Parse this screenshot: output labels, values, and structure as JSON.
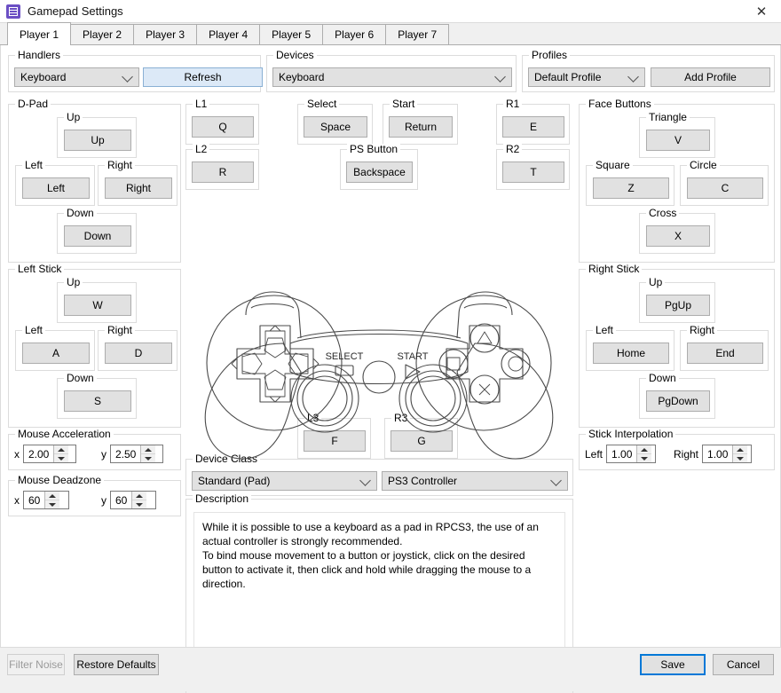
{
  "window": {
    "title": "Gamepad Settings",
    "icon": "rpcs3-icon",
    "close_label": "✕"
  },
  "tabs": [
    {
      "label": "Player 1",
      "active": true
    },
    {
      "label": "Player 2",
      "active": false
    },
    {
      "label": "Player 3",
      "active": false
    },
    {
      "label": "Player 4",
      "active": false
    },
    {
      "label": "Player 5",
      "active": false
    },
    {
      "label": "Player 6",
      "active": false
    },
    {
      "label": "Player 7",
      "active": false
    }
  ],
  "handlers": {
    "title": "Handlers",
    "value": "Keyboard",
    "refresh_label": "Refresh"
  },
  "devices": {
    "title": "Devices",
    "value": "Keyboard"
  },
  "profiles": {
    "title": "Profiles",
    "value": "Default Profile",
    "add_label": "Add Profile"
  },
  "dpad": {
    "title": "D-Pad",
    "up_label": "Up",
    "up_value": "Up",
    "left_label": "Left",
    "left_value": "Left",
    "right_label": "Right",
    "right_value": "Right",
    "down_label": "Down",
    "down_value": "Down"
  },
  "left_stick": {
    "title": "Left Stick",
    "up_label": "Up",
    "up_value": "W",
    "left_label": "Left",
    "left_value": "A",
    "right_label": "Right",
    "right_value": "D",
    "down_label": "Down",
    "down_value": "S"
  },
  "right_stick": {
    "title": "Right Stick",
    "up_label": "Up",
    "up_value": "PgUp",
    "left_label": "Left",
    "left_value": "Home",
    "right_label": "Right",
    "right_value": "End",
    "down_label": "Down",
    "down_value": "PgDown"
  },
  "face_buttons": {
    "title": "Face Buttons",
    "triangle_label": "Triangle",
    "triangle_value": "V",
    "square_label": "Square",
    "square_value": "Z",
    "circle_label": "Circle",
    "circle_value": "C",
    "cross_label": "Cross",
    "cross_value": "X"
  },
  "shoulders": {
    "l1_label": "L1",
    "l1_value": "Q",
    "l2_label": "L2",
    "l2_value": "R",
    "r1_label": "R1",
    "r1_value": "E",
    "r2_label": "R2",
    "r2_value": "T",
    "l3_label": "L3",
    "l3_value": "F",
    "r3_label": "R3",
    "r3_value": "G"
  },
  "center": {
    "select_label": "Select",
    "select_value": "Space",
    "start_label": "Start",
    "start_value": "Return",
    "ps_label": "PS Button",
    "ps_value": "Backspace"
  },
  "mouse_acceleration": {
    "title": "Mouse Acceleration",
    "x_label": "x",
    "x_value": "2.00",
    "y_label": "y",
    "y_value": "2.50"
  },
  "mouse_deadzone": {
    "title": "Mouse Deadzone",
    "x_label": "x",
    "x_value": "60",
    "y_label": "y",
    "y_value": "60"
  },
  "stick_interpolation": {
    "title": "Stick Interpolation",
    "left_label": "Left",
    "left_value": "1.00",
    "right_label": "Right",
    "right_value": "1.00"
  },
  "device_class": {
    "title": "Device Class",
    "class_value": "Standard (Pad)",
    "controller_value": "PS3 Controller"
  },
  "description": {
    "title": "Description",
    "text": "While it is possible to use a keyboard as a pad in RPCS3, the use of an actual controller is strongly recommended.\nTo bind mouse movement to a button or joystick, click on the desired button to activate it, then click and hold while dragging the mouse to a direction."
  },
  "controller_art": {
    "select_label": "SELECT",
    "start_label": "START"
  },
  "footer": {
    "filter_noise_label": "Filter Noise",
    "restore_defaults_label": "Restore Defaults",
    "save_label": "Save",
    "cancel_label": "Cancel"
  },
  "colors": {
    "accent": "#0078d7",
    "window_bg": "#f0f0f0",
    "surface": "#ffffff",
    "button_face": "#e1e1e1",
    "border": "#adadad",
    "group_border": "#dcdcdc"
  }
}
